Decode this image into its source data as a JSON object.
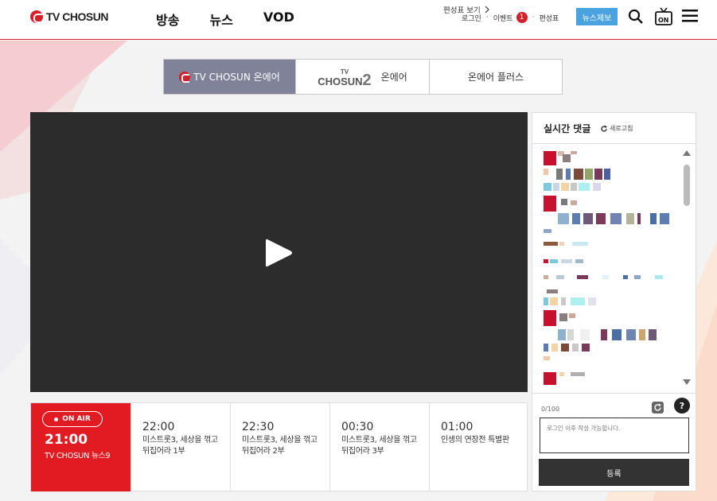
{
  "header": {
    "logo_text": "TV CHOSUN",
    "nav": [
      "방송",
      "뉴스",
      "VOD"
    ],
    "util": {
      "login": "로그인",
      "event": "이벤트",
      "event_badge": "1",
      "schedule": "편성표"
    },
    "news_tip_button": "뉴스제보"
  },
  "tabs": [
    {
      "label": "TV CHOSUN 온에어",
      "active": true
    },
    {
      "logo_small": "TV",
      "logo_main": "CHOSUN",
      "logo_num": "2",
      "label": "온에어",
      "active": false
    },
    {
      "label": "온에어 플러스",
      "active": false
    }
  ],
  "schedule": {
    "onair_badge": "ON AIR",
    "current": {
      "time": "21:00",
      "title": "TV CHOSUN 뉴스9"
    },
    "items": [
      {
        "time": "22:00",
        "title": "미스트롯3, 세상을 꺾고 뒤집어라 1부"
      },
      {
        "time": "22:30",
        "title": "미스트롯3, 세상을 꺾고 뒤집어라 2부"
      },
      {
        "time": "00:30",
        "title": "미스트롯3, 세상을 꺾고 뒤집어라 3부"
      },
      {
        "time": "01:00",
        "title": "인생의 연장전 특별판"
      }
    ],
    "view_link": "편성표 보기"
  },
  "chat": {
    "title": "실시간 댓글",
    "refresh": "새로고침",
    "counter": "0/100",
    "input_placeholder": "로그인 이후 작성 가능합니다.",
    "submit": "등록"
  },
  "colors": {
    "brand_red": "#e21b22",
    "tab_active": "#7f8299",
    "news_btn": "#4aa3df",
    "video_bg": "#2c2c2c"
  }
}
